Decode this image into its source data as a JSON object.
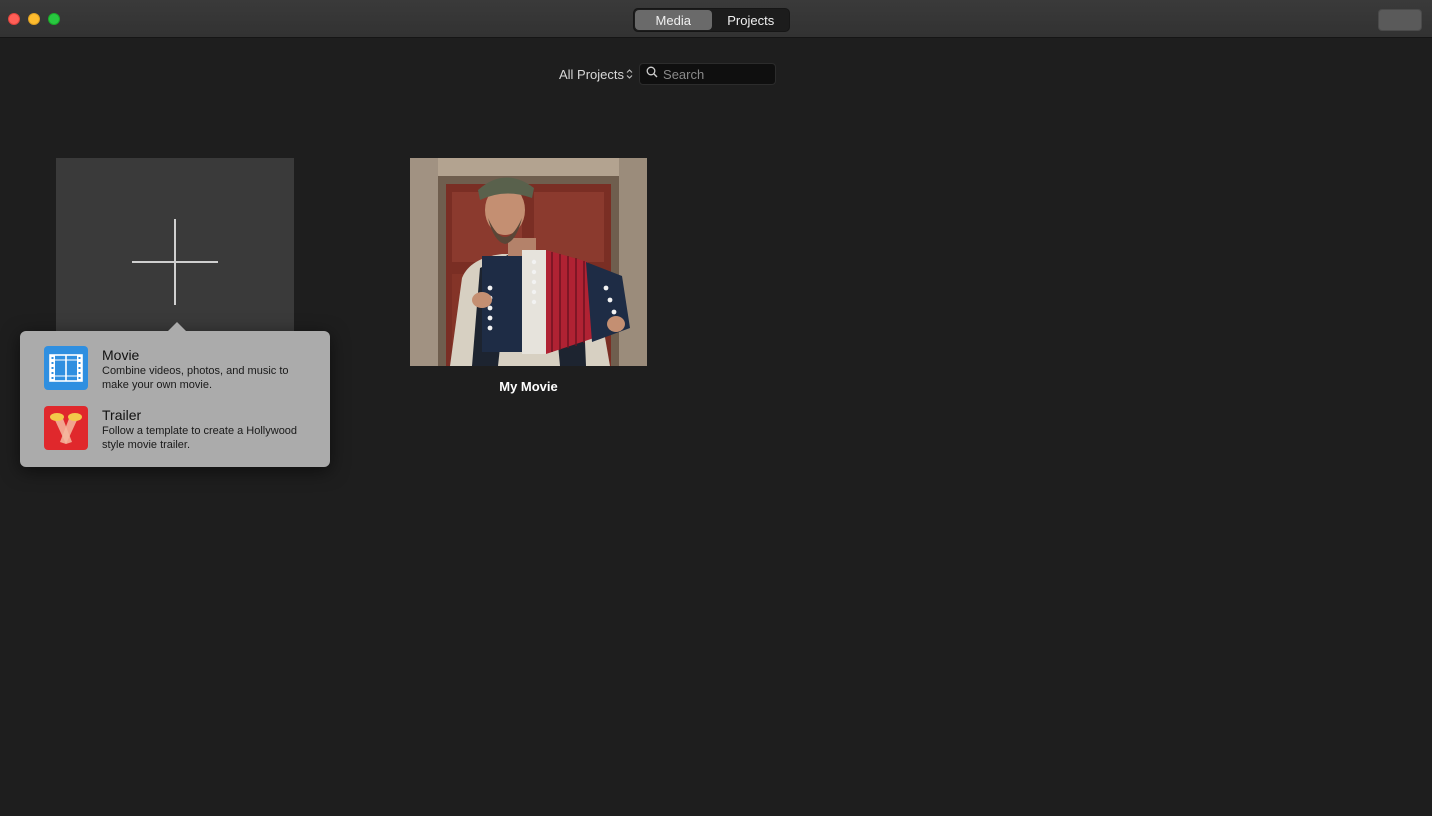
{
  "window": {
    "tabs": [
      {
        "label": "Media",
        "active": true
      },
      {
        "label": "Projects",
        "active": false
      }
    ]
  },
  "filter": {
    "selected": "All Projects",
    "search_placeholder": "Search"
  },
  "new_project_popover": {
    "items": [
      {
        "title": "Movie",
        "description": "Combine videos, photos, and music to make your own movie.",
        "icon": "film-strip-icon"
      },
      {
        "title": "Trailer",
        "description": "Follow a template to create a Hollywood style movie trailer.",
        "icon": "trailer-spotlights-icon"
      }
    ]
  },
  "projects": [
    {
      "title": "My Movie",
      "thumbnail": "accordion-player-thumbnail"
    }
  ],
  "colors": {
    "background": "#1e1e1e",
    "titlebar": "#353535",
    "popover": "#ababab",
    "movie_icon": "#2f8fe0",
    "trailer_icon": "#e0282c"
  }
}
